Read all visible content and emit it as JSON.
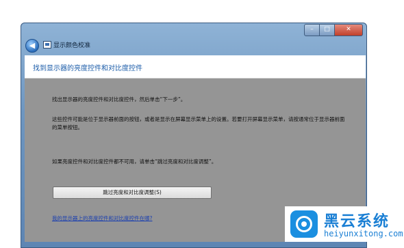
{
  "window": {
    "title": "显示颜色校准",
    "controls": {
      "minimize": "–",
      "maximize": "□",
      "close": "✕"
    }
  },
  "nav": {
    "back_glyph": "◀",
    "forward_glyph": "▶"
  },
  "header": {
    "title": "找到显示器的亮度控件和对比度控件"
  },
  "body": {
    "para1": "找出显示器的亮度控件和对比度控件，然后单击“下一步”。",
    "para2": "这些控件可能是位于显示器前面的按钮，或者是显示在屏幕显示菜单上的设置。若要打开屏幕显示菜单，请按通常位于显示器前面的菜单按钮。",
    "para3": "如果亮度控件和对比度控件都不可用，请单击“跳过亮度和对比度调整”。",
    "skip_button": "跳过亮度和对比度调整(S)",
    "help_link": "我的显示器上的亮度控件和对比度控件在哪?"
  },
  "watermark": {
    "name": "黑云系统",
    "url": "heiyunxitong.com"
  },
  "colors": {
    "header_title": "#1a5ba8",
    "content_bg": "#959595",
    "brand": "#1a7fd4"
  },
  "icons": {
    "back": "back-arrow-icon",
    "forward": "forward-arrow-icon",
    "app": "display-calibration-icon",
    "logo": "heiyun-logo-icon"
  }
}
